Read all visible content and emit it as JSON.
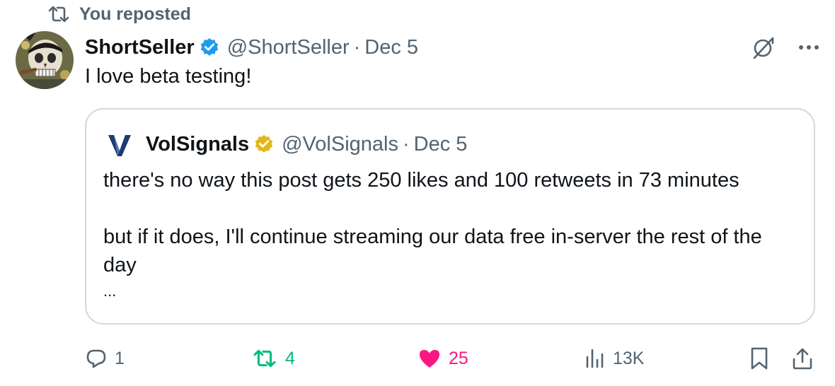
{
  "repost_banner": {
    "text": "You reposted"
  },
  "post": {
    "author_name": "ShortSeller",
    "handle": "@ShortSeller",
    "separator": "·",
    "date": "Dec 5",
    "text": "I love beta testing!"
  },
  "quoted_post": {
    "author_name": "VolSignals",
    "handle": "@VolSignals",
    "separator": "·",
    "date": "Dec 5",
    "avatar_letter": "V",
    "paragraph1": "there's no way this post gets 250 likes and 100 retweets in 73 minutes",
    "paragraph2": "but if it does, I'll continue streaming our data free in-server the rest of the day",
    "ellipsis": "..."
  },
  "actions": {
    "replies": "1",
    "reposts": "4",
    "likes": "25",
    "views": "13K"
  },
  "colors": {
    "text": "#0f1419",
    "muted": "#536471",
    "verified_blue": "#1d9bf0",
    "verified_gold": "#e2b719",
    "repost_green": "#00ba7c",
    "like_pink": "#f91880",
    "border": "#cfd9de"
  },
  "icons": {
    "repost_banner": "repost-icon",
    "verified": "verified-badge-icon",
    "grok": "grok-icon",
    "more": "more-icon",
    "reply": "reply-icon",
    "repost": "repost-icon",
    "like": "like-heart-icon",
    "views": "views-icon",
    "bookmark": "bookmark-icon",
    "share": "share-icon"
  }
}
